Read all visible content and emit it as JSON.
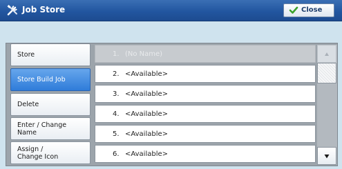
{
  "header": {
    "title": "Job Store",
    "title_icon": "wrench-screwdriver-icon",
    "close_label": "Close",
    "close_icon": "checkmark-icon"
  },
  "sidebar": {
    "items": [
      {
        "label": "Store",
        "active": false
      },
      {
        "label": "Store Build Job",
        "active": true
      },
      {
        "label": "Delete",
        "active": false
      },
      {
        "label": "Enter / Change\nName",
        "active": false
      },
      {
        "label": "Assign /\nChange Icon",
        "active": false
      }
    ]
  },
  "list": {
    "rows": [
      {
        "num": "1.",
        "name": "(No Name)",
        "disabled": true
      },
      {
        "num": "2.",
        "name": "<Available>",
        "disabled": false
      },
      {
        "num": "3.",
        "name": "<Available>",
        "disabled": false
      },
      {
        "num": "4.",
        "name": "<Available>",
        "disabled": false
      },
      {
        "num": "5.",
        "name": "<Available>",
        "disabled": false
      },
      {
        "num": "6.",
        "name": "<Available>",
        "disabled": false
      }
    ]
  },
  "scrollbar": {
    "up_icon": "scroll-up-arrow-icon",
    "down_icon": "scroll-down-arrow-icon"
  },
  "colors": {
    "header": "#2256a0",
    "active": "#2f7cd9",
    "background": "#cfe3ee"
  }
}
